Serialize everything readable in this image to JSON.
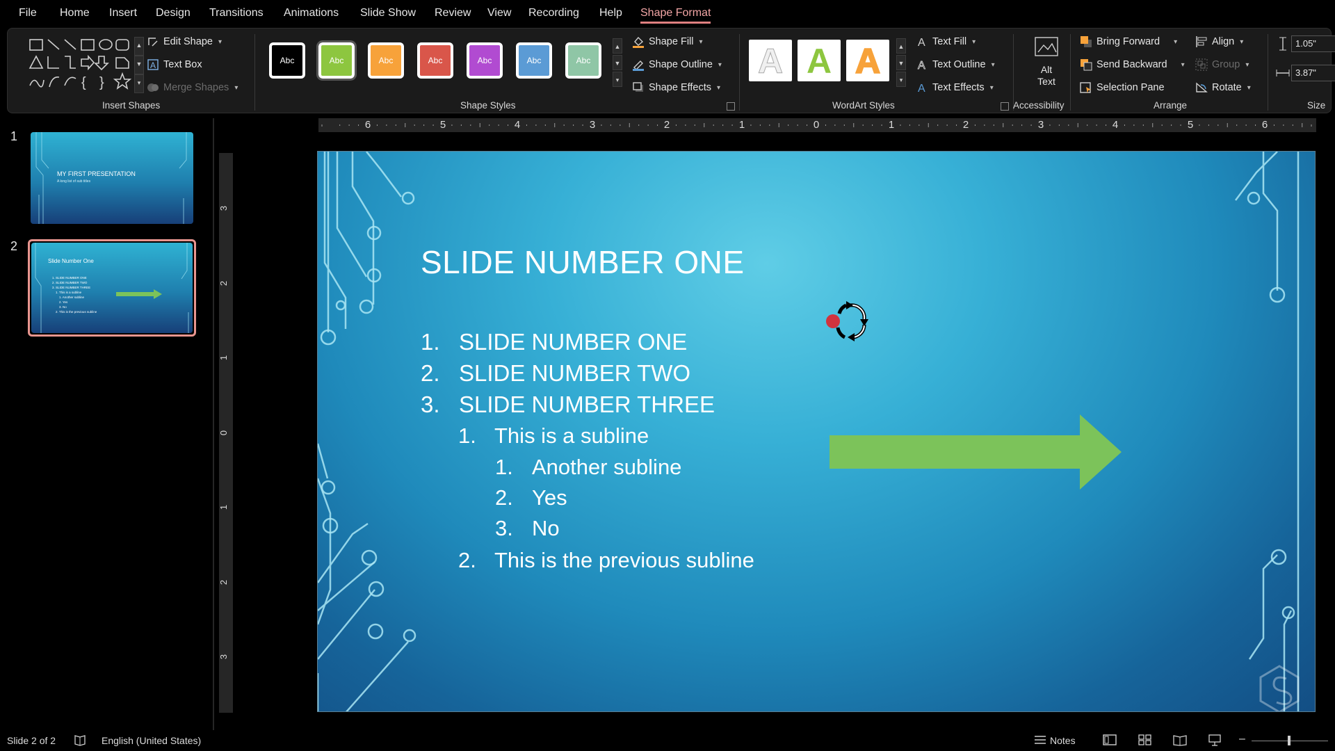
{
  "menu": {
    "items": [
      "File",
      "Home",
      "Insert",
      "Design",
      "Transitions",
      "Animations",
      "Slide Show",
      "Review",
      "View",
      "Recording",
      "Help",
      "Shape Format"
    ],
    "active": "Shape Format"
  },
  "ribbon": {
    "insert_shapes": {
      "label": "Insert Shapes",
      "edit_shape": "Edit Shape",
      "text_box": "Text Box",
      "merge_shapes": "Merge Shapes"
    },
    "shape_styles": {
      "label": "Shape Styles",
      "swatch_text": "Abc",
      "swatches": [
        {
          "color": "#000000"
        },
        {
          "color": "#8dc63f"
        },
        {
          "color": "#f7a23a"
        },
        {
          "color": "#d9564a"
        },
        {
          "color": "#b14bd1"
        },
        {
          "color": "#5b9bd5"
        },
        {
          "color": "#8fc6a6"
        }
      ],
      "shape_fill": "Shape Fill",
      "shape_outline": "Shape Outline",
      "shape_effects": "Shape Effects"
    },
    "wordart_styles": {
      "label": "WordArt Styles",
      "letter": "A",
      "samples": [
        {
          "color": "#f0f0f0"
        },
        {
          "color": "#8dc63f"
        },
        {
          "color": "#f7a23a"
        }
      ],
      "text_fill": "Text Fill",
      "text_outline": "Text Outline",
      "text_effects": "Text Effects"
    },
    "accessibility": {
      "label": "Accessibility",
      "alt_text_line1": "Alt",
      "alt_text_line2": "Text"
    },
    "arrange": {
      "label": "Arrange",
      "bring_forward": "Bring Forward",
      "send_backward": "Send Backward",
      "selection_pane": "Selection Pane",
      "align": "Align",
      "group": "Group",
      "rotate": "Rotate"
    },
    "size": {
      "label": "Size",
      "height": "1.05\"",
      "width": "3.87\""
    }
  },
  "ruler": {
    "horizontal": [
      "6",
      "5",
      "4",
      "3",
      "2",
      "1",
      "0",
      "1",
      "2",
      "3",
      "4",
      "5",
      "6"
    ],
    "vertical": [
      "3",
      "2",
      "1",
      "0",
      "1",
      "2",
      "3"
    ]
  },
  "thumbnails": [
    {
      "number": "1",
      "title": "MY FIRST PRESENTATION",
      "subtitle": "A long list of sub titles",
      "selected": false
    },
    {
      "number": "2",
      "title": "Slide Number One",
      "selected": true,
      "lines": [
        "1. SLIDE NUMBER ONE",
        "2. SLIDE NUMBER TWO",
        "3. SLIDE NUMBER THREE",
        "1. This is a subline",
        "1. Another subline",
        "2. Yes",
        "3. No",
        "2. This is the previous subline"
      ]
    }
  ],
  "slide": {
    "title": "SLIDE NUMBER ONE",
    "list": [
      {
        "num": "1.",
        "text": "SLIDE NUMBER ONE",
        "level": 1
      },
      {
        "num": "2.",
        "text": "SLIDE NUMBER TWO",
        "level": 1
      },
      {
        "num": "3.",
        "text": "SLIDE NUMBER THREE",
        "level": 1
      },
      {
        "num": "1.",
        "text": "This is a subline",
        "level": 2
      },
      {
        "num": "1.",
        "text": "Another subline",
        "level": 3
      },
      {
        "num": "2.",
        "text": "Yes",
        "level": 3
      },
      {
        "num": "3.",
        "text": "No",
        "level": 3
      },
      {
        "num": "2.",
        "text": "This is the previous subline",
        "level": 2
      }
    ],
    "arrow_color": "#7cc35a"
  },
  "status": {
    "slide_indicator": "Slide 2 of 2",
    "language": "English (United States)",
    "notes": "Notes"
  }
}
